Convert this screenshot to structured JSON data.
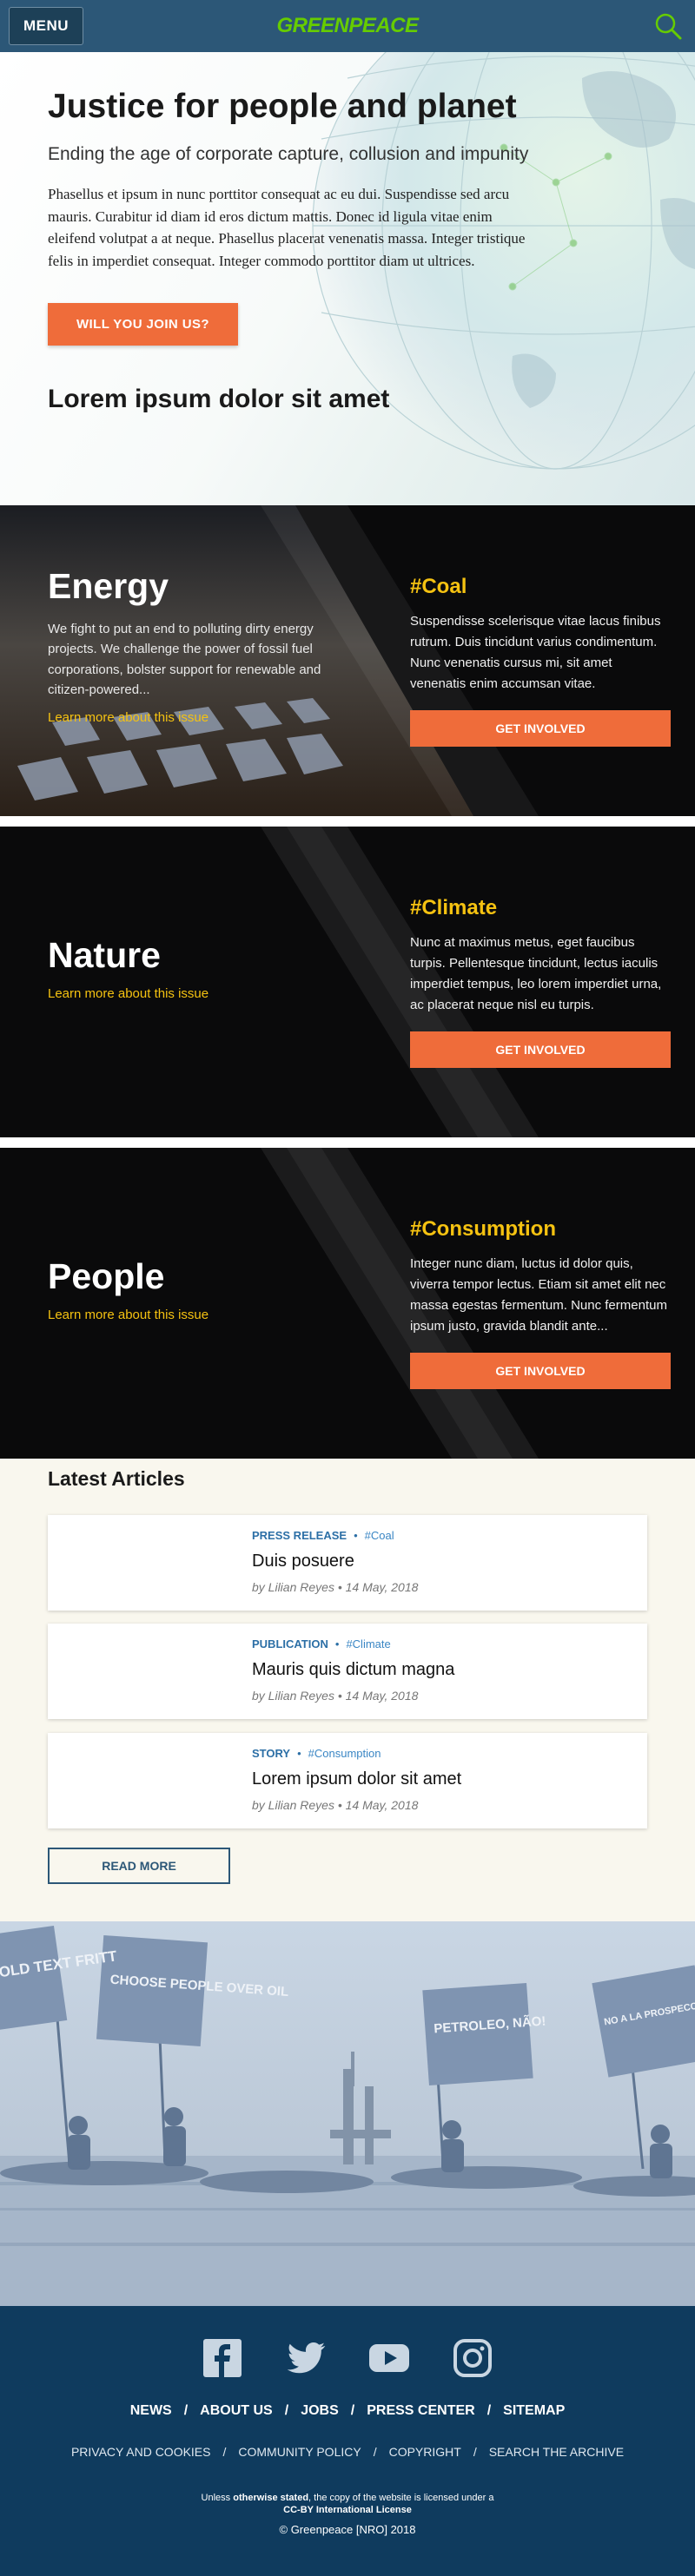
{
  "header": {
    "menu_label": "MENU",
    "logo_text": "GREENPEACE",
    "search_icon": "search-icon"
  },
  "hero": {
    "title": "Justice for people and planet",
    "subtitle": "Ending the age of corporate capture, collusion and impunity",
    "body": "Phasellus et ipsum in nunc porttitor consequat ac eu dui. Suspendisse sed arcu mauris. Curabitur id diam id eros dictum mattis. Donec id ligula vitae enim eleifend volutpat a at neque. Phasellus placerat venenatis massa. Integer tristique felis in imperdiet consequat. Integer commodo porttitor diam ut ultrices.",
    "cta_label": "WILL YOU JOIN US?",
    "section_heading": "Lorem ipsum dolor sit amet"
  },
  "issues": [
    {
      "name": "Energy",
      "description": "We fight to put an end to polluting dirty energy projects. We challenge the power of fossil fuel corporations, bolster support for renewable and citizen-powered...",
      "link": "Learn more about this issue",
      "tag": "#Coal",
      "tag_text": "Suspendisse scelerisque vitae lacus finibus rutrum. Duis tincidunt varius condimentum. Nunc venenatis cursus mi, sit amet venenatis enim accumsan vitae.",
      "button": "GET INVOLVED"
    },
    {
      "name": "Nature",
      "link": "Learn more about this issue",
      "tag": "#Climate",
      "tag_text": "Nunc at maximus metus, eget faucibus turpis. Pellentesque tincidunt, lectus iaculis imperdiet tempus, leo lorem imperdiet urna, ac placerat neque nisl eu turpis.",
      "button": "GET INVOLVED"
    },
    {
      "name": "People",
      "link": "Learn more about this issue",
      "tag": "#Consumption",
      "tag_text": "Integer nunc diam, luctus id dolor quis, viverra tempor lectus. Etiam sit amet elit nec massa egestas fermentum. Nunc fermentum ipsum justo, gravida blandit ante...",
      "button": "GET INVOLVED"
    }
  ],
  "articles": {
    "heading": "Latest Articles",
    "items": [
      {
        "type": "PRESS RELEASE",
        "tag": "#Coal",
        "title": "Duis posuere",
        "byline": "by Lilian Reyes • 14 May, 2018"
      },
      {
        "type": "PUBLICATION",
        "tag": "#Climate",
        "title": "Mauris quis dictum magna",
        "byline": "by Lilian Reyes • 14 May, 2018"
      },
      {
        "type": "STORY",
        "tag": "#Consumption",
        "title": "Lorem ipsum dolor sit amet",
        "byline": "by Lilian Reyes • 14 May, 2018"
      }
    ],
    "read_more": "READ MORE"
  },
  "photo": {
    "banners": [
      "OLD TEXT FRITT",
      "CHOOSE PEOPLE OVER OIL",
      "PETROLEO, NÃO!",
      "NO A LA PROSPECCIÓN EN EL ÁRTICO"
    ]
  },
  "footer": {
    "social_icons": [
      "facebook-icon",
      "twitter-icon",
      "youtube-icon",
      "instagram-icon"
    ],
    "main_links": [
      "NEWS",
      "ABOUT US",
      "JOBS",
      "PRESS CENTER",
      "SITEMAP"
    ],
    "sub_links": [
      "PRIVACY AND COOKIES",
      "COMMUNITY POLICY",
      "COPYRIGHT",
      "SEARCH THE ARCHIVE"
    ],
    "license_prefix": "Unless ",
    "license_bold1": "otherwise stated",
    "license_mid": ", the copy of the website is licensed under a ",
    "license_bold2": "CC-BY International License",
    "copyright": "© Greenpeace [NRO] 2018"
  },
  "colors": {
    "header_bg": "#2c5777",
    "logo_green": "#66cc00",
    "accent_orange": "#ef6c3a",
    "tag_yellow": "#f5c211",
    "footer_bg": "#0f3b5e",
    "articles_bg": "#f9f7ee"
  }
}
